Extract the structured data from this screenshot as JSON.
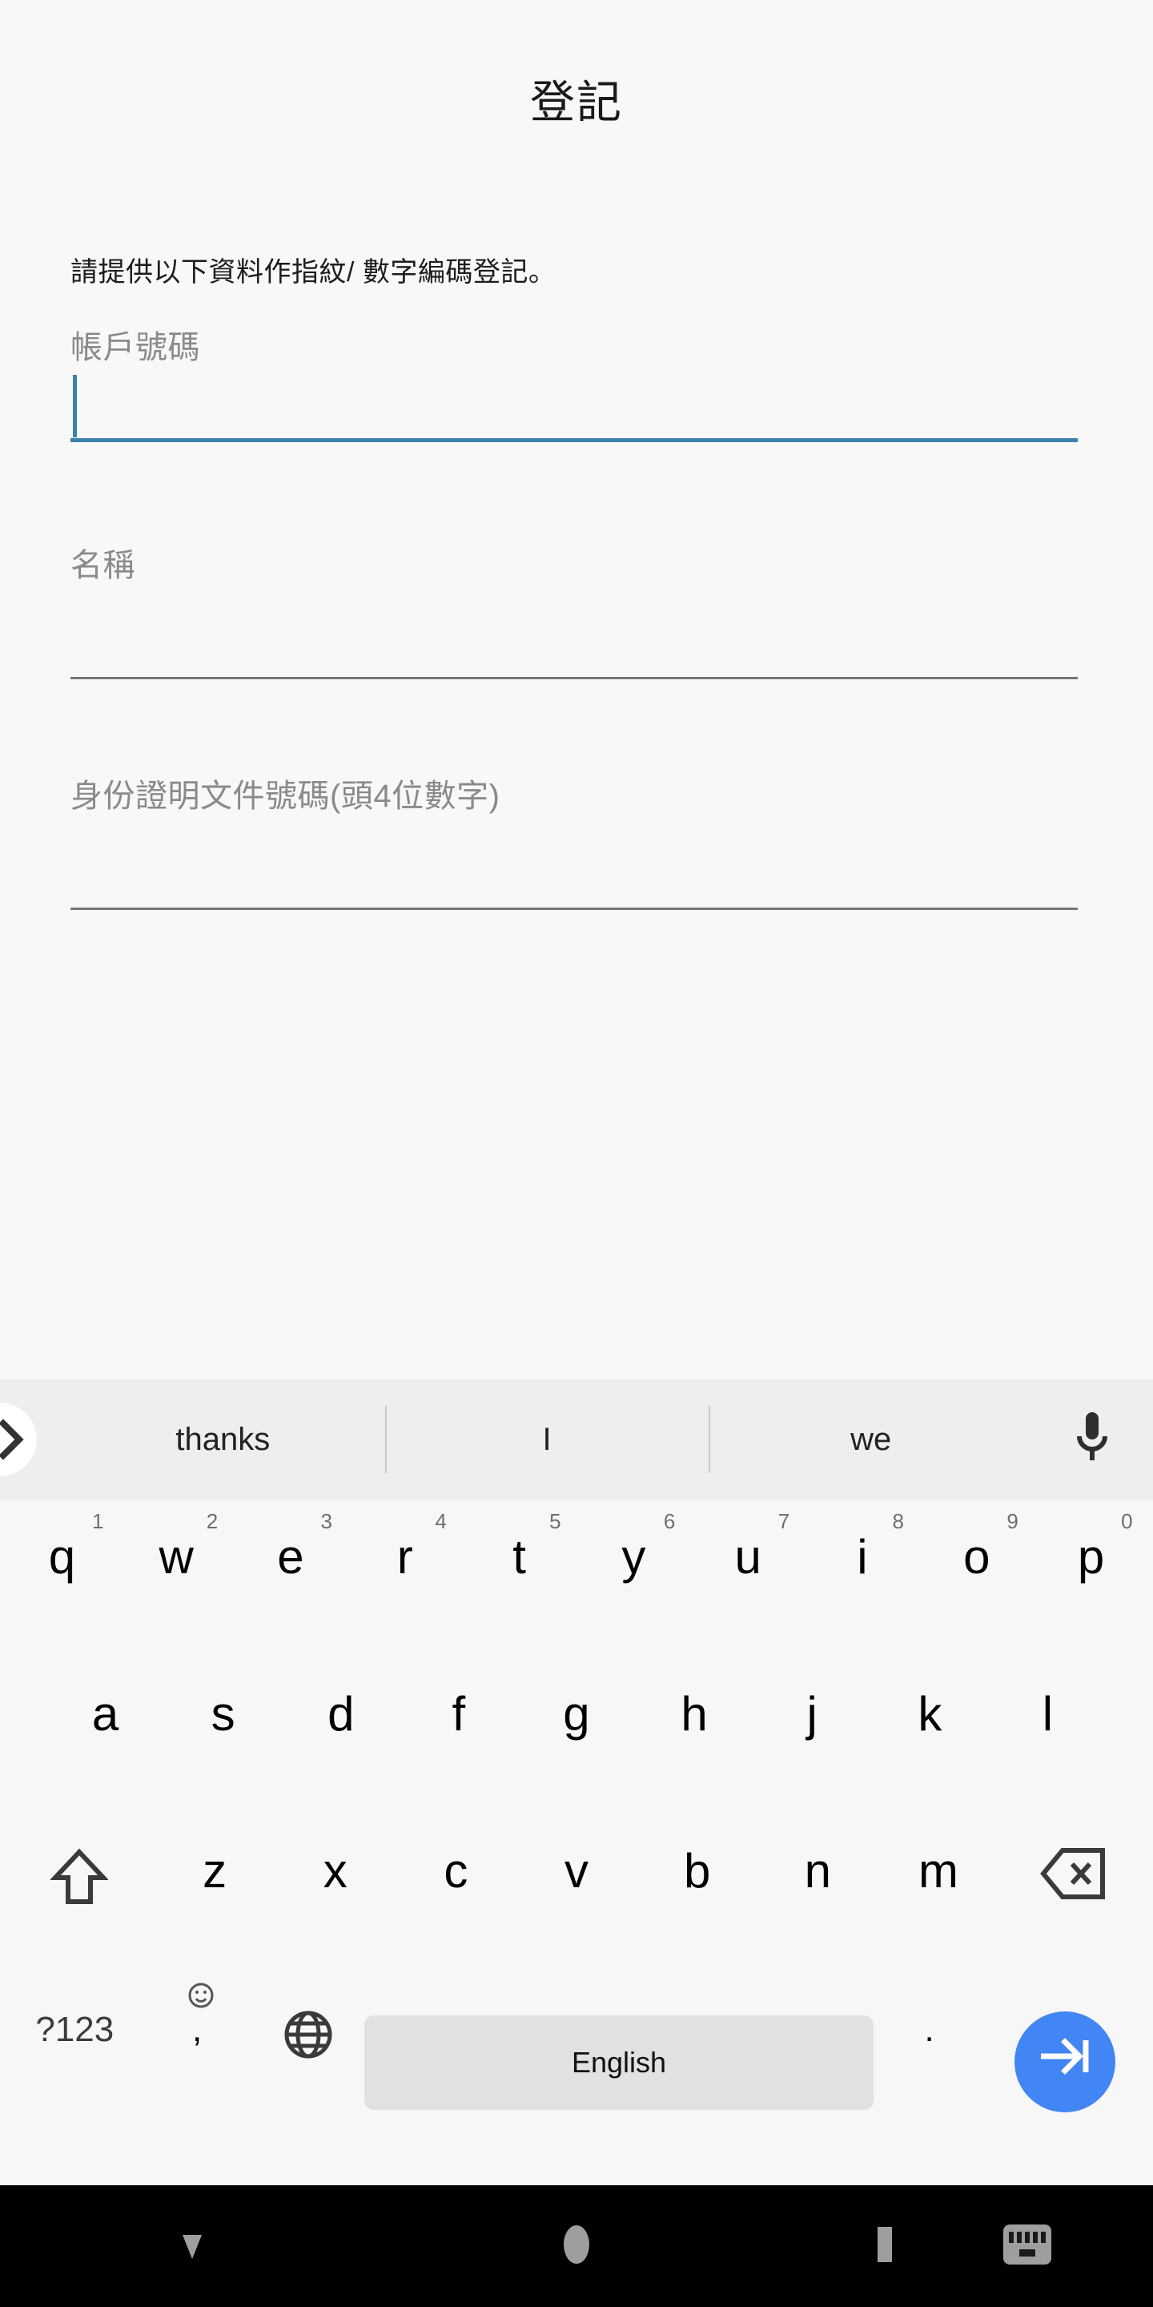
{
  "app": {
    "title": "登記",
    "instruction": "請提供以下資料作指紋/ 數字編碼登記。"
  },
  "colors": {
    "accent_focus": "#3C81AC",
    "enter_key": "#4285F4",
    "content_bg": "#F8F8F8",
    "suggestion_bg": "#EEEEEE",
    "keyboard_bg": "#F7F7F7",
    "navbar_bg": "#000000",
    "label_text": "#8A8A8A",
    "underline_idle": "#757575",
    "spacebar_bg": "#E1E1E1"
  },
  "form": {
    "fields": [
      {
        "label": "帳戶號碼",
        "value": "",
        "placeholder": "",
        "focused": true
      },
      {
        "label": "名稱",
        "value": "",
        "placeholder": "",
        "focused": false
      },
      {
        "label": "身份證明文件號碼(頭4位數字)",
        "value": "",
        "placeholder": "",
        "focused": false
      }
    ]
  },
  "keyboard": {
    "expand_icon": "chevron-right-icon",
    "mic_icon": "microphone-icon",
    "suggestions": [
      "thanks",
      "I",
      "we"
    ],
    "row1": [
      {
        "key": "q",
        "hint": "1"
      },
      {
        "key": "w",
        "hint": "2"
      },
      {
        "key": "e",
        "hint": "3"
      },
      {
        "key": "r",
        "hint": "4"
      },
      {
        "key": "t",
        "hint": "5"
      },
      {
        "key": "y",
        "hint": "6"
      },
      {
        "key": "u",
        "hint": "7"
      },
      {
        "key": "i",
        "hint": "8"
      },
      {
        "key": "o",
        "hint": "9"
      },
      {
        "key": "p",
        "hint": "0"
      }
    ],
    "row2": [
      "a",
      "s",
      "d",
      "f",
      "g",
      "h",
      "j",
      "k",
      "l"
    ],
    "row3": {
      "shift_icon": "shift-icon",
      "letters": [
        "z",
        "x",
        "c",
        "v",
        "b",
        "n",
        "m"
      ],
      "backspace_icon": "backspace-icon"
    },
    "row4": {
      "symbols_label": "?123",
      "comma_label": ",",
      "emoji_hint_icon": "emoji-icon",
      "globe_icon": "globe-icon",
      "space_label": "English",
      "period_label": ".",
      "enter_icon": "tab-next-icon"
    }
  },
  "navbar": {
    "items": [
      {
        "icon": "back-down-icon",
        "name": "hide-keyboard"
      },
      {
        "icon": "home-circle-icon",
        "name": "home"
      },
      {
        "icon": "recents-square-icon",
        "name": "recents"
      },
      {
        "icon": "keyboard-switch-icon",
        "name": "switch-keyboard"
      }
    ]
  }
}
